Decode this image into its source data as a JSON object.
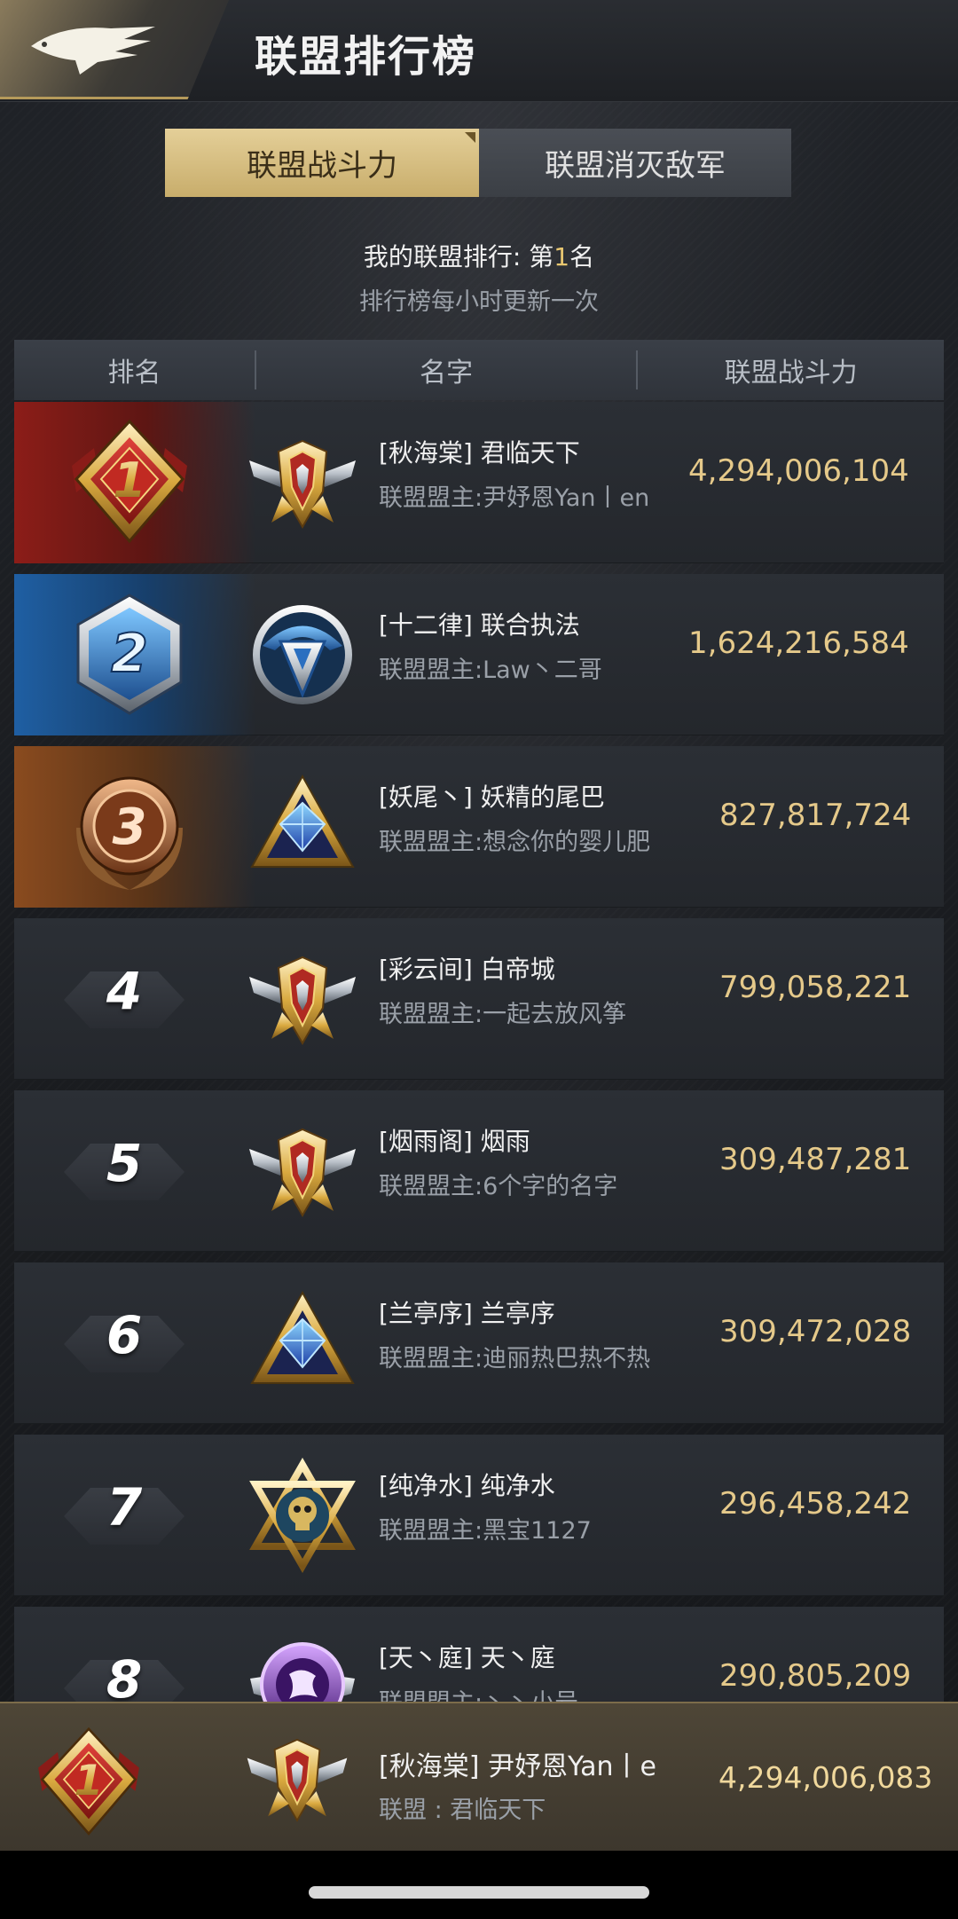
{
  "header": {
    "title": "联盟排行榜",
    "back_icon": "eagle-wing-icon"
  },
  "tabs": [
    {
      "label": "联盟战斗力",
      "active": true
    },
    {
      "label": "联盟消灭敌军",
      "active": false
    }
  ],
  "my_rank": {
    "prefix": "我的联盟排行: 第",
    "number": "1",
    "suffix": "名",
    "update_note": "排行榜每小时更新一次"
  },
  "table": {
    "columns": [
      "排名",
      "名字",
      "联盟战斗力"
    ]
  },
  "rows": [
    {
      "rank": "1",
      "alliance": "[秋海棠] 君临天下",
      "leader": "联盟盟主:尹妤恩Yan丨en",
      "power": "4,294,006,104",
      "emblem": "winged-gold-shield-icon"
    },
    {
      "rank": "2",
      "alliance": "[十二律] 联合执法",
      "leader": "联盟盟主:Law丶二哥",
      "power": "1,624,216,584",
      "emblem": "blue-eagle-shield-icon"
    },
    {
      "rank": "3",
      "alliance": "[妖尾丶] 妖精的尾巴",
      "leader": "联盟盟主:想念你的婴儿肥",
      "power": "827,817,724",
      "emblem": "blue-crystal-triangle-icon"
    },
    {
      "rank": "4",
      "alliance": "[彩云间] 白帝城",
      "leader": "联盟盟主:一起去放风筝",
      "power": "799,058,221",
      "emblem": "winged-gold-shield-icon"
    },
    {
      "rank": "5",
      "alliance": "[烟雨阁] 烟雨",
      "leader": "联盟盟主:6个字的名字",
      "power": "309,487,281",
      "emblem": "winged-gold-shield-icon"
    },
    {
      "rank": "6",
      "alliance": "[兰亭序] 兰亭序",
      "leader": "联盟盟主:迪丽热巴热不热",
      "power": "309,472,028",
      "emblem": "blue-crystal-triangle-icon"
    },
    {
      "rank": "7",
      "alliance": "[纯净水] 纯净水",
      "leader": "联盟盟主:黑宝1127",
      "power": "296,458,242",
      "emblem": "star-skull-emblem-icon"
    },
    {
      "rank": "8",
      "alliance": "[天丶庭] 天丶庭",
      "leader": "联盟盟主:丶丶小号",
      "power": "290,805,209",
      "emblem": "purple-crest-icon"
    }
  ],
  "my_row": {
    "rank": "1",
    "alliance": "[秋海棠] 尹妤恩Yan丨e",
    "leader": "联盟 : 君临天下",
    "power": "4,294,006,083",
    "emblem": "winged-gold-shield-icon"
  },
  "colors": {
    "gold": "#e5c98a",
    "tab_active": "#d6bd80",
    "rank1": "#8c1d18",
    "rank2": "#1f5fa3",
    "rank3": "#8a4b1f"
  }
}
